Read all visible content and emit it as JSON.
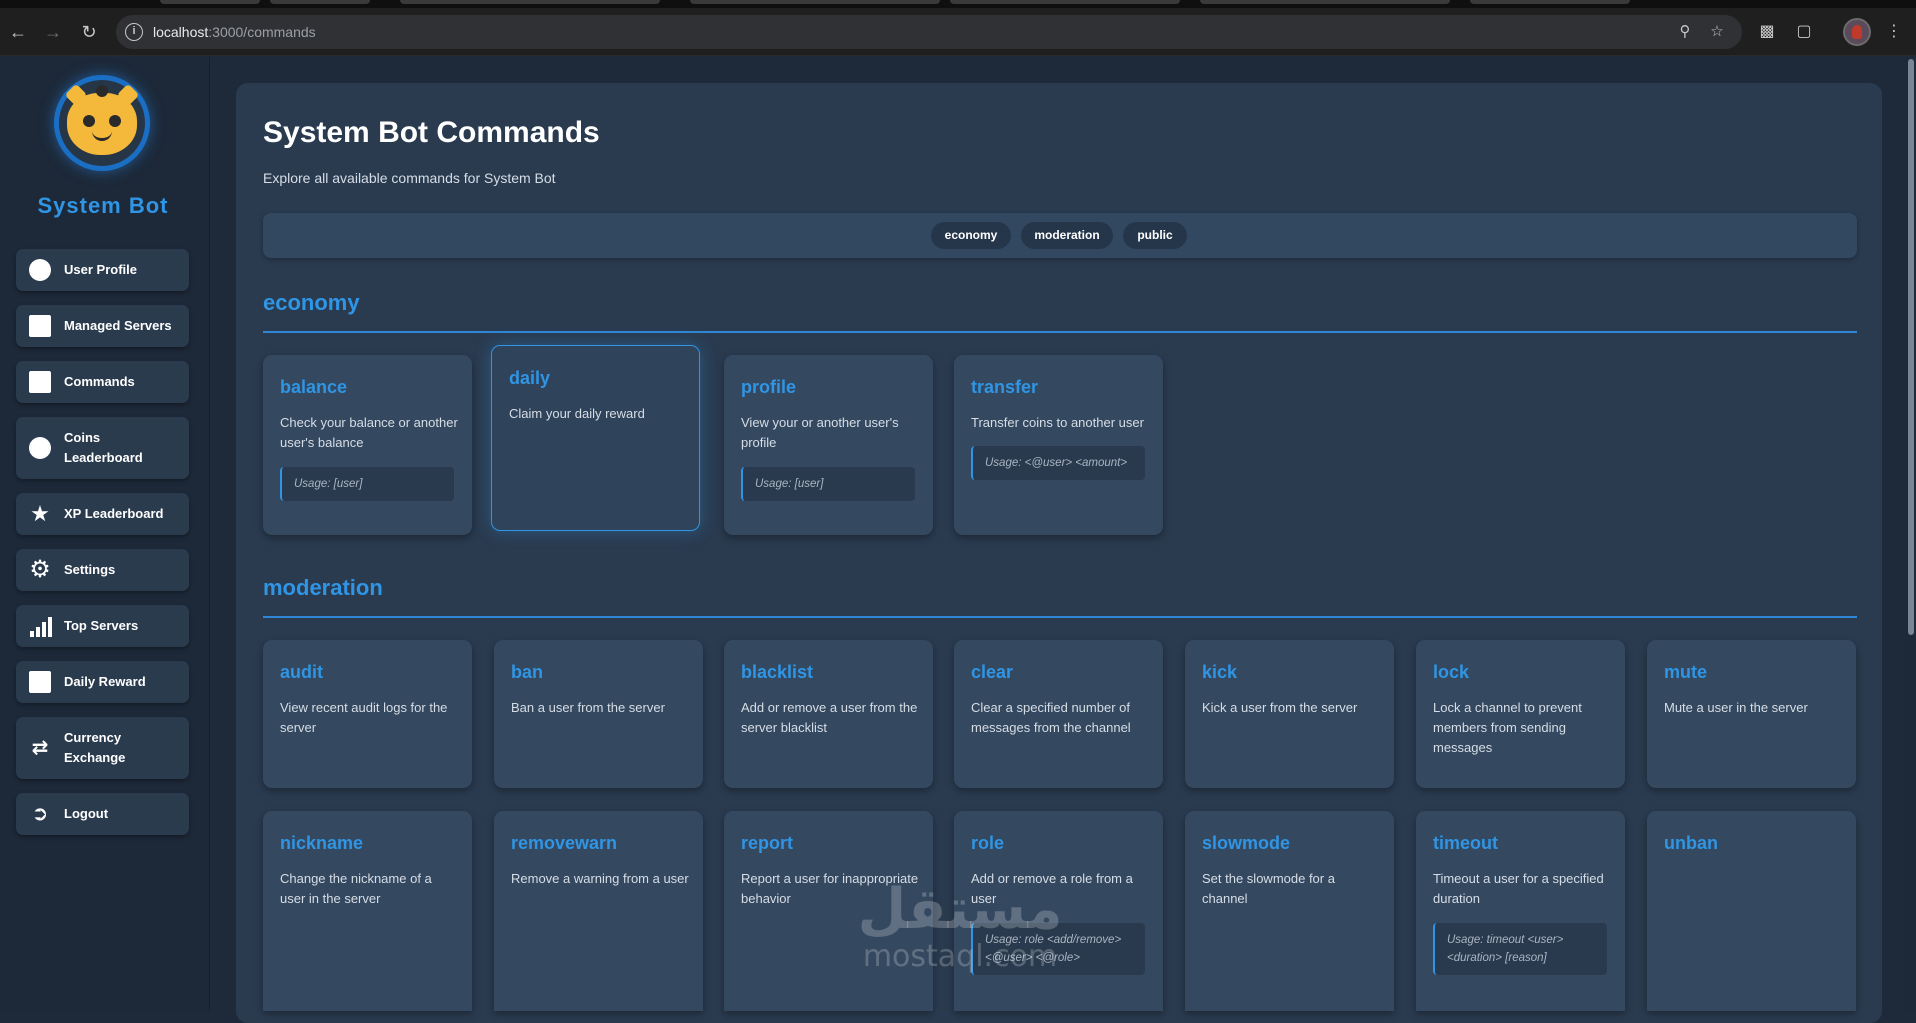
{
  "browser": {
    "url_host": "localhost",
    "url_rest": ":3000/commands"
  },
  "sidebar": {
    "brand": "System Bot",
    "items": [
      {
        "label": "User Profile",
        "icon": "user-icon"
      },
      {
        "label": "Managed Servers",
        "icon": "server-icon"
      },
      {
        "label": "Commands",
        "icon": "terminal-icon"
      },
      {
        "label": "Coins Leaderboard",
        "icon": "coins-icon"
      },
      {
        "label": "XP Leaderboard",
        "icon": "star-icon"
      },
      {
        "label": "Settings",
        "icon": "gear-icon"
      },
      {
        "label": "Top Servers",
        "icon": "chart-icon"
      },
      {
        "label": "Daily Reward",
        "icon": "gift-icon"
      },
      {
        "label": "Currency Exchange",
        "icon": "exchange-icon"
      },
      {
        "label": "Logout",
        "icon": "logout-icon"
      }
    ]
  },
  "main": {
    "title": "System Bot Commands",
    "subtitle": "Explore all available commands for System Bot",
    "filters": [
      "economy",
      "moderation",
      "public"
    ],
    "sections": [
      {
        "title": "economy",
        "commands": [
          {
            "name": "balance",
            "desc": "Check your balance or another user's balance",
            "usage": "Usage: [user]"
          },
          {
            "name": "daily",
            "desc": "Claim your daily reward",
            "usage": ""
          },
          {
            "name": "profile",
            "desc": "View your or another user's profile",
            "usage": "Usage: [user]"
          },
          {
            "name": "transfer",
            "desc": "Transfer coins to another user",
            "usage": "Usage: <@user> <amount>"
          }
        ]
      },
      {
        "title": "moderation",
        "commands": [
          {
            "name": "audit",
            "desc": "View recent audit logs for the server",
            "usage": ""
          },
          {
            "name": "ban",
            "desc": "Ban a user from the server",
            "usage": ""
          },
          {
            "name": "blacklist",
            "desc": "Add or remove a user from the server blacklist",
            "usage": ""
          },
          {
            "name": "clear",
            "desc": "Clear a specified number of messages from the channel",
            "usage": ""
          },
          {
            "name": "kick",
            "desc": "Kick a user from the server",
            "usage": ""
          },
          {
            "name": "lock",
            "desc": "Lock a channel to prevent members from sending messages",
            "usage": ""
          },
          {
            "name": "mute",
            "desc": "Mute a user in the server",
            "usage": ""
          },
          {
            "name": "nickname",
            "desc": "Change the nickname of a user in the server",
            "usage": ""
          },
          {
            "name": "removewarn",
            "desc": "Remove a warning from a user",
            "usage": ""
          },
          {
            "name": "report",
            "desc": "Report a user for inappropriate behavior",
            "usage": ""
          },
          {
            "name": "role",
            "desc": "Add or remove a role from a user",
            "usage": "Usage: role <add/remove> <@user> <@role>"
          },
          {
            "name": "slowmode",
            "desc": "Set the slowmode for a channel",
            "usage": ""
          },
          {
            "name": "timeout",
            "desc": "Timeout a user for a specified duration",
            "usage": "Usage: timeout <user> <duration> [reason]"
          },
          {
            "name": "unban",
            "desc": "",
            "usage": ""
          }
        ]
      }
    ]
  },
  "watermark": {
    "arabic": "مستقل",
    "latin": "mostaql.com"
  },
  "colors": {
    "accent": "#2f95e4",
    "panel": "#2a3b50",
    "card": "#34485f",
    "sidebar": "#1d2939"
  }
}
